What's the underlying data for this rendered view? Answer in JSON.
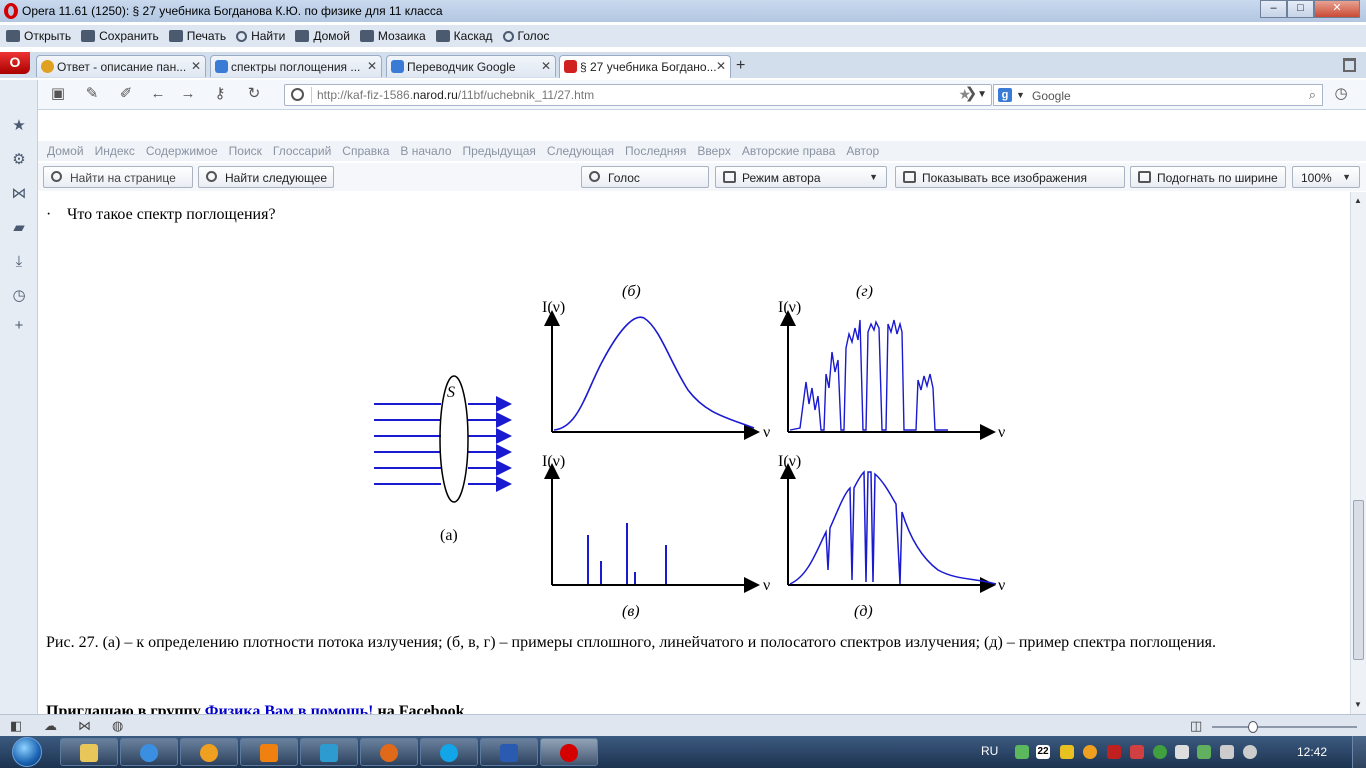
{
  "window": {
    "title": "Opera 11.61 (1250): § 27 учебника Богданова К.Ю. по физике для 11 класса",
    "minimize": "–",
    "maximize": "□",
    "close": "✕"
  },
  "commands": [
    {
      "label": "Открыть",
      "icon": "folder-icon"
    },
    {
      "label": "Сохранить",
      "icon": "save-icon"
    },
    {
      "label": "Печать",
      "icon": "print-icon"
    },
    {
      "label": "Найти",
      "icon": "find-icon"
    },
    {
      "label": "Домой",
      "icon": "home-icon"
    },
    {
      "label": "Мозаика",
      "icon": "tiles-icon"
    },
    {
      "label": "Каскад",
      "icon": "cascade-icon"
    },
    {
      "label": "Голос",
      "icon": "voice-icon"
    }
  ],
  "tabs": [
    {
      "label": "Ответ - описание пан...",
      "favicon_color": "#e0a020",
      "active": false
    },
    {
      "label": "спектры поглощения ...",
      "favicon_color": "#3a7bd5",
      "active": false
    },
    {
      "label": "Переводчик Google",
      "favicon_color": "#3a7bd5",
      "active": false
    },
    {
      "label": "§ 27 учебника Богдано...",
      "favicon_color": "#d02020",
      "active": true
    }
  ],
  "new_tab": "+",
  "address": {
    "prefix": "http://kaf-fiz-1586.",
    "domain": "narod.ru",
    "path": "/11bf/uchebnik_11/27.htm"
  },
  "search": {
    "placeholder": "Google",
    "engine_letter": "g"
  },
  "site_nav": [
    "Домой",
    "Индекс",
    "Содержимое",
    "Поиск",
    "Глоссарий",
    "Справка",
    "В начало",
    "Предыдущая",
    "Следующая",
    "Последняя",
    "Вверх",
    "Авторские права",
    "Автор"
  ],
  "reader": {
    "find_placeholder": "Найти на странице",
    "find_next": "Найти следующее",
    "voice": "Голос",
    "author_mode": "Режим автора",
    "show_images": "Показывать все изображения",
    "fit_width": "Подогнать по ширине",
    "zoom": "100%"
  },
  "content": {
    "bullet_dot": "·",
    "bullet_text": "Что такое спектр поглощения?",
    "caption_prefix": "Рис. 27. (",
    "caption": "Рис. 27. (а) – к определению плотности потока излучения; (б, в, г) – примеры сплошного, линейчатого и полосатого спектров излучения; (д) – пример спектра поглощения.",
    "promo_before": "Приглашаю в группу ",
    "promo_link": "Физика Вам в помощь!",
    "promo_after": " на Facebook"
  },
  "figure": {
    "line_color": "#1a1ad0",
    "label_a": "(а)",
    "label_b": "(б)",
    "label_v": "(в)",
    "label_g": "(г)",
    "label_d": "(д)",
    "surface_label": "S",
    "y_axis_label": "I(ν)",
    "x_axis_label": "ν"
  },
  "taskbar": {
    "language": "RU",
    "calendar_day": "22",
    "time": "12:42"
  }
}
